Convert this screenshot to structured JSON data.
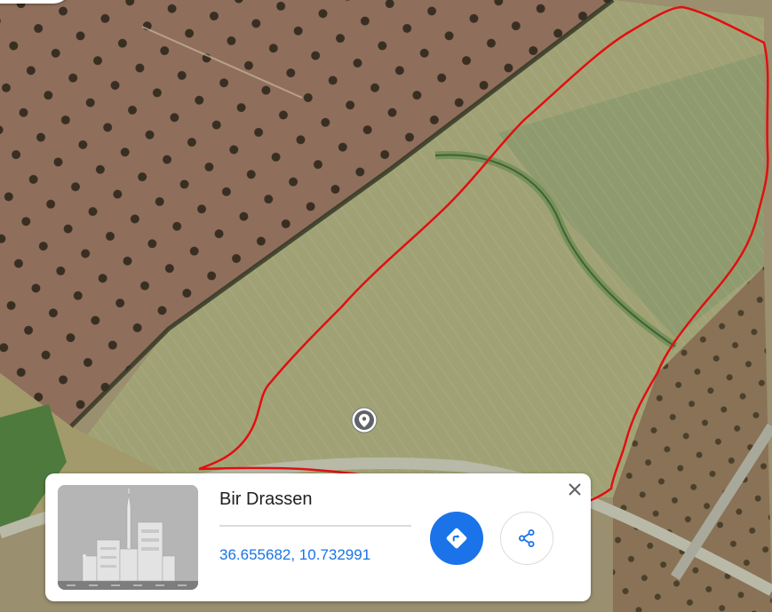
{
  "place": {
    "name": "Bir Drassen",
    "coordinates": "36.655682, 10.732991"
  },
  "colors": {
    "boundary": "#e01010",
    "accent": "#1a73e8"
  },
  "icons": {
    "pin": "map-pin-icon",
    "directions": "directions-icon",
    "share": "share-icon",
    "close": "close-icon"
  }
}
